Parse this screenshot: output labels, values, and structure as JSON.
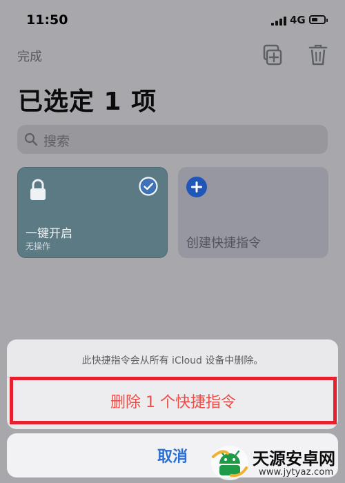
{
  "status_bar": {
    "time": "11:50",
    "network": "4G"
  },
  "header": {
    "done": "完成",
    "title": "已选定 1 项"
  },
  "search": {
    "placeholder": "搜索"
  },
  "shortcuts": [
    {
      "title": "一键开启",
      "subtitle": "无操作"
    },
    {
      "title": "创建快捷指令"
    }
  ],
  "sheet": {
    "message": "此快捷指令会从所有 iCloud 设备中删除。",
    "delete_label": "删除 1 个快捷指令",
    "cancel_label": "取消"
  },
  "watermark": {
    "title": "天源安卓网",
    "url": "www.jytyaz.com"
  },
  "colors": {
    "accent_blue": "#2a6fd3",
    "danger_red": "#ea4d48",
    "highlight_border": "#e5202f",
    "selected_card": "#5b7a84"
  },
  "icons": {
    "duplicate": "duplicate-icon",
    "trash": "trash-icon",
    "search": "search-icon",
    "lock": "lock-icon",
    "check": "checkmark-circle-icon",
    "plus": "plus-circle-icon"
  }
}
